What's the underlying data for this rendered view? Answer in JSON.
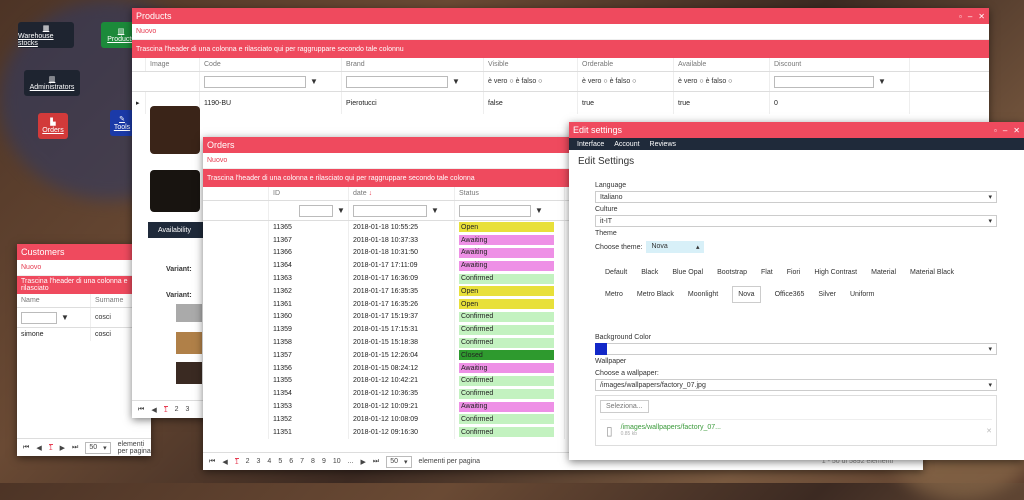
{
  "desktop": {
    "icons": [
      {
        "label": "Warehouse stocks",
        "icon": "warehouse-icon"
      },
      {
        "label": "Products",
        "icon": "products-icon"
      },
      {
        "label": "Administrators",
        "icon": "bank-icon"
      },
      {
        "label": "Orders",
        "icon": "chart-icon"
      },
      {
        "label": "Tools",
        "icon": "tools-icon"
      }
    ]
  },
  "products": {
    "title": "Products",
    "nuovo": "Nuovo",
    "group_hint": "Trascina l'header di una colonna e rilasciato qui per raggruppare secondo tale colonnu",
    "columns": [
      "Image",
      "Code",
      "Brand",
      "Visible",
      "Orderable",
      "Available",
      "Discount"
    ],
    "bool_filter": {
      "true": "è vero",
      "false": "è falso"
    },
    "row": {
      "code": "1190-BU",
      "brand": "Pierotucci",
      "visible": "false",
      "orderable": "true",
      "available": "true",
      "discount": "0"
    },
    "availability": "Availability",
    "variant": "Variant:",
    "pages": [
      "1",
      "2",
      "3"
    ]
  },
  "customers": {
    "title": "Customers",
    "nuovo": "Nuovo",
    "group_hint": "Trascina l'header di una colonna e rilasciato",
    "columns": [
      "Name",
      "Surname"
    ],
    "filter_surname": "cosci",
    "row": {
      "name": "simone",
      "surname": "cosci"
    },
    "page": "1",
    "page_size": "50",
    "per_page": "elementi per pagina"
  },
  "orders": {
    "title": "Orders",
    "nuovo": "Nuovo",
    "group_hint": "Trascina l'header di una colonna e rilasciato qui per raggruppare secondo tale colonna",
    "columns": [
      "ID",
      "date",
      "Status"
    ],
    "rows": [
      [
        "11365",
        "2018-01-18 10:55:25",
        "Open"
      ],
      [
        "11367",
        "2018-01-18 10:37:33",
        "Awaiting"
      ],
      [
        "11366",
        "2018-01-18 10:31:50",
        "Awaiting"
      ],
      [
        "11364",
        "2018-01-17 17:11:09",
        "Awaiting"
      ],
      [
        "11363",
        "2018-01-17 16:36:09",
        "Confirmed"
      ],
      [
        "11362",
        "2018-01-17 16:35:35",
        "Open"
      ],
      [
        "11361",
        "2018-01-17 16:35:26",
        "Open"
      ],
      [
        "11360",
        "2018-01-17 15:19:37",
        "Confirmed"
      ],
      [
        "11359",
        "2018-01-15 17:15:31",
        "Confirmed"
      ],
      [
        "11358",
        "2018-01-15 15:18:38",
        "Confirmed"
      ],
      [
        "11357",
        "2018-01-15 12:26:04",
        "Closed"
      ],
      [
        "11356",
        "2018-01-15 08:24:12",
        "Awaiting"
      ],
      [
        "11355",
        "2018-01-12 10:42:21",
        "Confirmed"
      ],
      [
        "11354",
        "2018-01-12 10:36:35",
        "Confirmed"
      ],
      [
        "11353",
        "2018-01-12 10:09:21",
        "Awaiting"
      ],
      [
        "11352",
        "2018-01-12 10:08:09",
        "Confirmed"
      ],
      [
        "11351",
        "2018-01-12 09:16:30",
        "Confirmed"
      ]
    ],
    "status_colors": {
      "Open": "#e8e03a",
      "Awaiting": "#ee90e6",
      "Confirmed": "#c3f2c0",
      "Closed": "#2e9a2e"
    },
    "pages": [
      "1",
      "2",
      "3",
      "4",
      "5",
      "6",
      "7",
      "8",
      "9",
      "10",
      "..."
    ],
    "page_size": "50",
    "per_page": "elementi per pagina",
    "count": "1 - 50 di 5892 elementi"
  },
  "settings": {
    "title": "Edit settings",
    "tabs": [
      "Interface",
      "Account",
      "Reviews"
    ],
    "heading": "Edit Settings",
    "language_label": "Language",
    "language": "Italiano",
    "culture_label": "Culture",
    "culture": "it-IT",
    "theme_label": "Theme",
    "choose_theme": "Choose theme:",
    "theme_value": "Nova",
    "themes_row1": [
      "Default",
      "Black",
      "Blue Opal",
      "Bootstrap",
      "Flat",
      "Fiori",
      "High Contrast",
      "Material",
      "Material Black"
    ],
    "themes_row2": [
      "Metro",
      "Metro Black",
      "Moonlight",
      "Nova",
      "Office365",
      "Silver",
      "Uniform"
    ],
    "bg_label": "Background Color",
    "bg_color": "#1228c8",
    "wallpaper_label": "Wallpaper",
    "choose_wallpaper": "Choose a wallpaper:",
    "wallpaper": "/images/wallpapers/factory_07.jpg",
    "select_btn": "Seleziona...",
    "file_name": "/images/wallpapers/factory_07...",
    "file_size": "0.85 kb"
  }
}
